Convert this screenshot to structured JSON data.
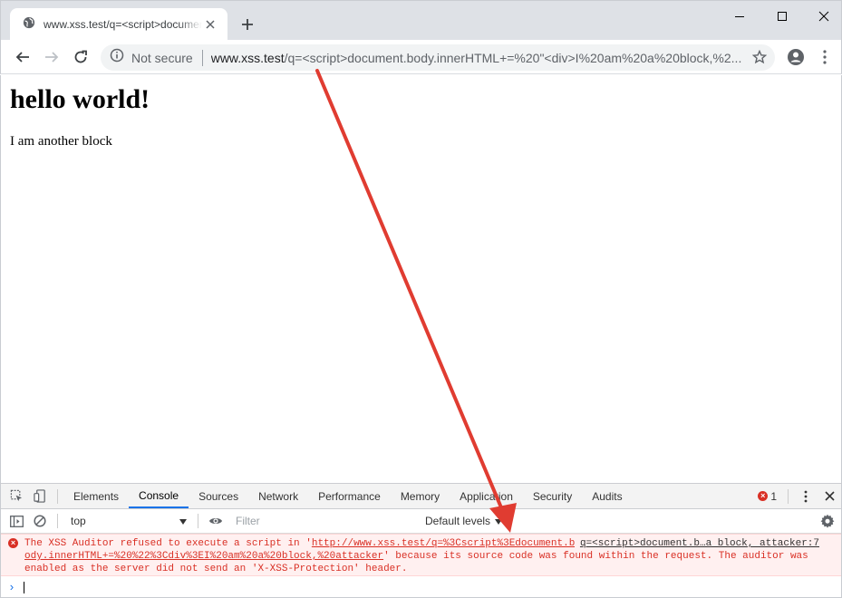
{
  "browser": {
    "tab": {
      "title": "www.xss.test/q=<script>document.body"
    },
    "omnibox": {
      "security_label": "Not secure",
      "url_host": "www.xss.test",
      "url_rest": "/q=<script>document.body.innerHTML+=%20\"<div>I%20am%20a%20block,%2..."
    }
  },
  "page": {
    "heading": "hello world!",
    "paragraph": "I am another block"
  },
  "devtools": {
    "tabs": [
      {
        "label": "Elements"
      },
      {
        "label": "Console",
        "active": true
      },
      {
        "label": "Sources"
      },
      {
        "label": "Network"
      },
      {
        "label": "Performance"
      },
      {
        "label": "Memory"
      },
      {
        "label": "Application"
      },
      {
        "label": "Security"
      },
      {
        "label": "Audits"
      }
    ],
    "error_count": "1",
    "console_toolbar": {
      "context": "top",
      "filter_placeholder": "Filter",
      "levels": "Default levels"
    },
    "error_message": {
      "line1_prefix": "The XSS Auditor refused to execute a script in '",
      "line1_link": "http://www.xss.test/q=%3Cscript%3Edocument.b",
      "line2_link": "ody.innerHTML+=%20%22%3Cdiv%3EI%20am%20a%20block,%20attacker",
      "line2_suffix": "' because its source code was found within the request. The auditor was",
      "line3": "enabled as the server did not send an 'X-XSS-Protection' header.",
      "source": "q=<script>document.b…a block, attacker:7"
    },
    "prompt": "›"
  },
  "colors": {
    "error_red": "#d93025",
    "annotation_arrow": "#e03c31",
    "active_tab_blue": "#1a73e8"
  }
}
